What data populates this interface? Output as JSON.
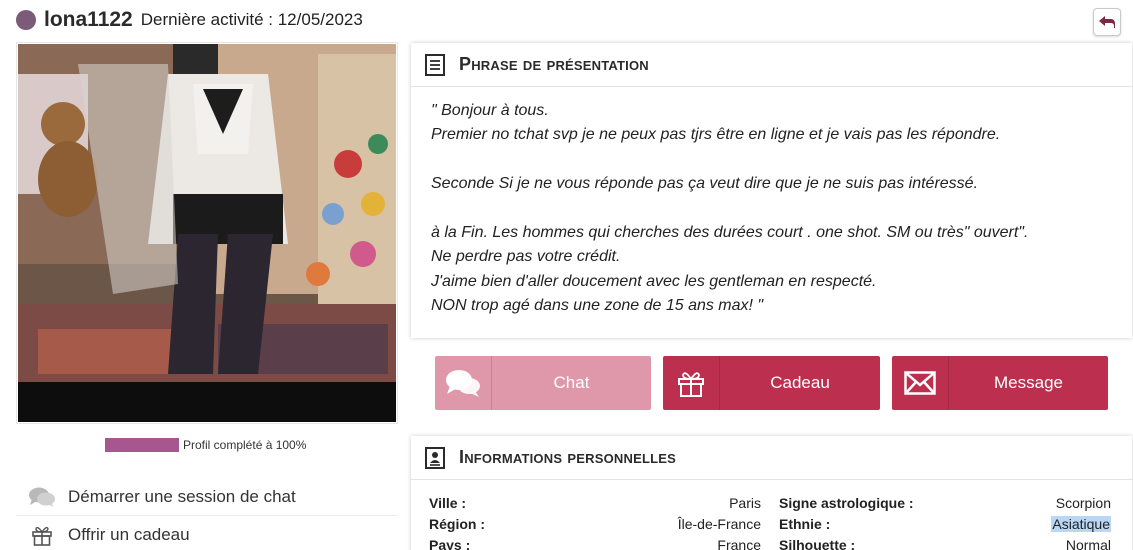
{
  "header": {
    "username": "lona1122",
    "last_activity": "Dernière activité : 12/05/2023",
    "status_color": "#7b5b78"
  },
  "profile": {
    "completion_label": "Profil complété à 100%",
    "completion_fraction": 1.0
  },
  "left_actions": [
    {
      "label": "Démarrer une session de chat",
      "icon": "chat-bubbles-icon"
    },
    {
      "label": "Offrir un cadeau",
      "icon": "gift-icon"
    }
  ],
  "intro": {
    "title": "Phrase de présentation",
    "lines": [
      "\" Bonjour à tous.",
      "Premier no tchat svp je ne peux pas tjrs être en ligne et je vais pas les répondre.",
      "",
      "Seconde Si je ne vous réponde pas ça veut dire que je ne suis pas intéressé.",
      "",
      "à la Fin. Les hommes qui cherches des durées court . one shot. SM ou très\" ouvert\".",
      "Ne perdre pas votre crédit.",
      "J'aime bien d'aller doucement avec les gentleman en respecté.",
      "NON trop agé dans une zone de 15 ans max! \""
    ]
  },
  "buttons": {
    "chat": "Chat",
    "gift": "Cadeau",
    "message": "Message"
  },
  "colors": {
    "accent": "#bc2f4f",
    "accent_light": "#df98aa",
    "progress": "#a8568f"
  },
  "info": {
    "title": "Informations personnelles",
    "left": [
      {
        "label": "Ville :",
        "value": "Paris"
      },
      {
        "label": "Région :",
        "value": "Île-de-France"
      },
      {
        "label": "Pays :",
        "value": "France"
      }
    ],
    "right": [
      {
        "label": "Signe astrologique :",
        "value": "Scorpion"
      },
      {
        "label": "Ethnie :",
        "value": "Asiatique"
      },
      {
        "label": "Silhouette :",
        "value": "Normal"
      }
    ]
  }
}
